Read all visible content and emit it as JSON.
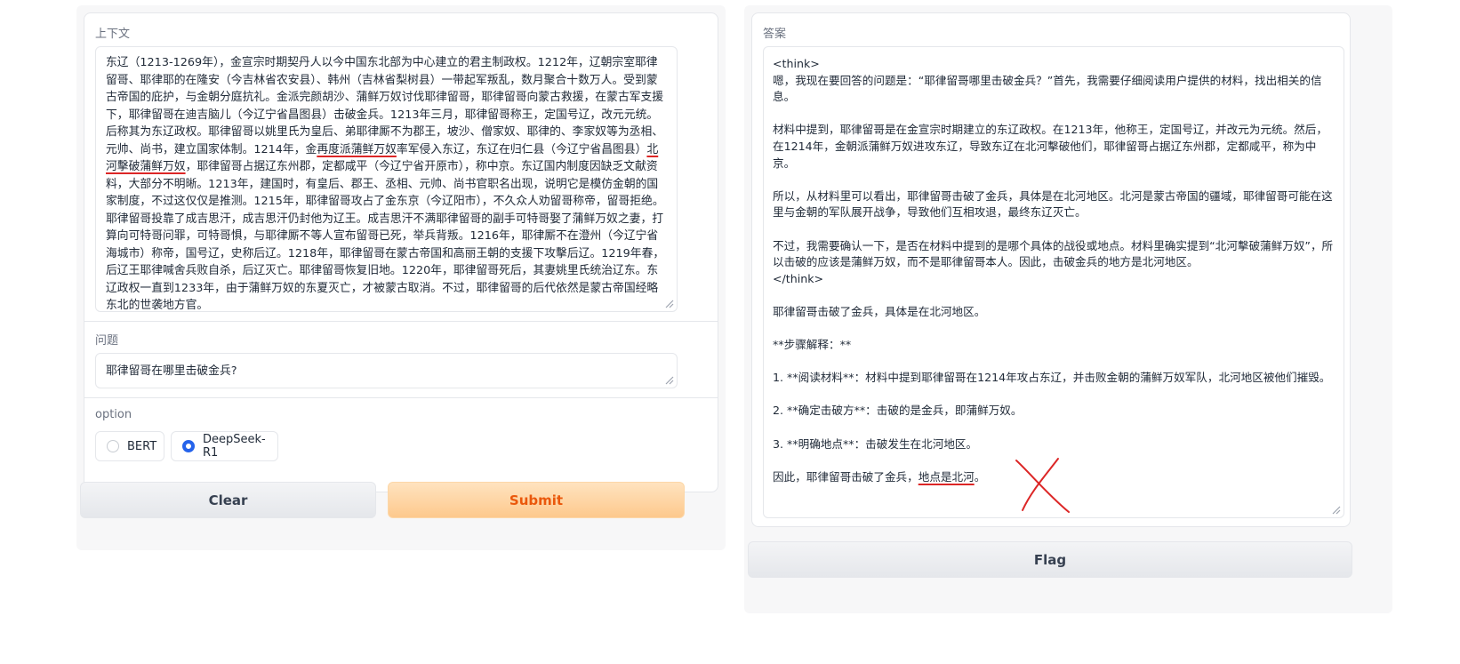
{
  "context": {
    "label": "上下文",
    "text_before_1": "东辽（1213-1269年），金宣宗时期契丹人以今中国东北部为中心建立的君主制政权。1212年，辽朝宗室耶律留哥、耶律耶的在隆安（今吉林省农安县）、韩州（吉林省梨树县）一带起军叛乱，数月聚合十数万人。受到蒙古帝国的庇护，与金朝分庭抗礼。金派完颜胡沙、蒲鲜万奴讨伐耶律留哥，耶律留哥向蒙古救援，在蒙古军支援下，耶律留哥在迪吉脑儿（今辽宁省昌图县）击破金兵。1213年三月，耶律留哥称王，定国号辽，改元元统。后称其为东辽政权。耶律留哥以姚里氏为皇后、弟耶律厮不为郡王，坡沙、僧家奴、耶律的、李家奴等为丞相、元帅、尚书，建立国家体制。1214年，金",
    "underline_1": "再度派蒲鲜万奴",
    "text_between": "率军侵入东辽，东辽在归仁县（今辽宁省昌图县）",
    "underline_2": "北河擊破蒲鲜万奴",
    "text_after": "，耶律留哥占据辽东州郡，定都咸平（今辽宁省开原市），称中京。东辽国内制度因缺乏文献资料，大部分不明晰。1213年，建国时，有皇后、郡王、丞相、元帅、尚书官职名出现，说明它是模仿金朝的国家制度，不过这仅仅是推测。1215年，耶律留哥攻占了金东京（今辽阳市），不久众人劝留哥称帝，留哥拒绝。耶律留哥投靠了成吉思汗，成吉思汗仍封他为辽王。成吉思汗不满耶律留哥的副手可特哥娶了蒲鲜万奴之妻，打算向可特哥问罪，可特哥惧，与耶律厮不等人宣布留哥已死，举兵背叛。1216年，耶律厮不在澄州（今辽宁省海城市）称帝，国号辽，史称后辽。1218年，耶律留哥在蒙古帝国和高丽王朝的支援下攻擊后辽。1219年春，后辽王耶律喊舍兵败自杀，后辽灭亡。耶律留哥恢复旧地。1220年，耶律留哥死后，其妻姚里氏统治辽东。东辽政权一直到1233年，由于蒲鲜万奴的东夏灭亡，才被蒙古取消。不过，耶律留哥的后代依然是蒙古帝国经略东北的世袭地方官。"
  },
  "question": {
    "label": "问题",
    "value": "耶律留哥在哪里击破金兵?"
  },
  "option": {
    "label": "option",
    "choices": [
      {
        "label": "BERT",
        "checked": false
      },
      {
        "label": "DeepSeek-R1",
        "checked": true
      }
    ]
  },
  "buttons": {
    "clear": "Clear",
    "submit": "Submit",
    "flag": "Flag"
  },
  "answer": {
    "label": "答案",
    "text_main": "<think>\n嗯，我现在要回答的问题是：“耶律留哥哪里击破金兵？”首先，我需要仔细阅读用户提供的材料，找出相关的信息。\n\n材料中提到，耶律留哥是在金宣宗时期建立的东辽政权。在1213年，他称王，定国号辽，并改元为元统。然后，在1214年，金朝派蒲鲜万奴进攻东辽，导致东辽在北河擊破他们，耶律留哥占据辽东州郡，定都咸平，称为中京。\n\n所以，从材料里可以看出，耶律留哥击破了金兵，具体是在北河地区。北河是蒙古帝国的疆域，耶律留哥可能在这里与金朝的军队展开战争，导致他们互相攻退，最终东辽灭亡。\n\n不过，我需要确认一下，是否在材料中提到的是哪个具体的战役或地点。材料里确实提到“北河擊破蒲鲜万奴”，所以击破的应该是蒲鲜万奴，而不是耶律留哥本人。因此，击破金兵的地方是北河地区。\n</think>\n\n耶律留哥击破了金兵，具体是在北河地区。\n\n**步骤解释：**\n\n1. **阅读材料**：材料中提到耶律留哥在1214年攻占东辽，并击败金朝的蒲鲜万奴军队，北河地区被他们摧毁。\n\n2. **确定击破方**：击破的是金兵，即蒲鲜万奴。\n\n3. **明确地点**：击破发生在北河地区。\n\n",
    "final_prefix": "因此，耶律留哥击破了金兵，",
    "final_underlined": "地点是北河",
    "final_suffix": "。"
  },
  "colors": {
    "accent_blue": "#2563eb",
    "submit_text": "#ea580c",
    "annotation_red": "#dc2626"
  }
}
